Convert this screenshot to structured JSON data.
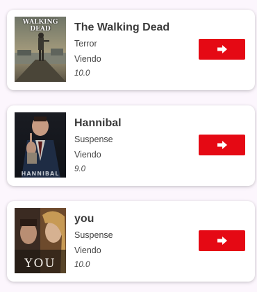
{
  "series_list": [
    {
      "title": "The Walking Dead",
      "genre": "Terror",
      "status": "Viendo",
      "rating": "10.0",
      "poster_text": "WALKING DEAD",
      "poster_icon": "walking-dead-poster",
      "button_icon": "arrow-right-icon"
    },
    {
      "title": "Hannibal",
      "genre": "Suspense",
      "status": "Viendo",
      "rating": "9.0",
      "poster_text": "HANNIBAL",
      "poster_icon": "hannibal-poster",
      "button_icon": "arrow-right-icon"
    },
    {
      "title": "you",
      "genre": "Suspense",
      "status": "Viendo",
      "rating": "10.0",
      "poster_text": "YOU",
      "poster_icon": "you-poster",
      "button_icon": "arrow-right-icon"
    }
  ],
  "colors": {
    "accent": "#e50914",
    "background": "#fcf6fd",
    "card": "#ffffff",
    "title_text": "#3b3b3b"
  }
}
